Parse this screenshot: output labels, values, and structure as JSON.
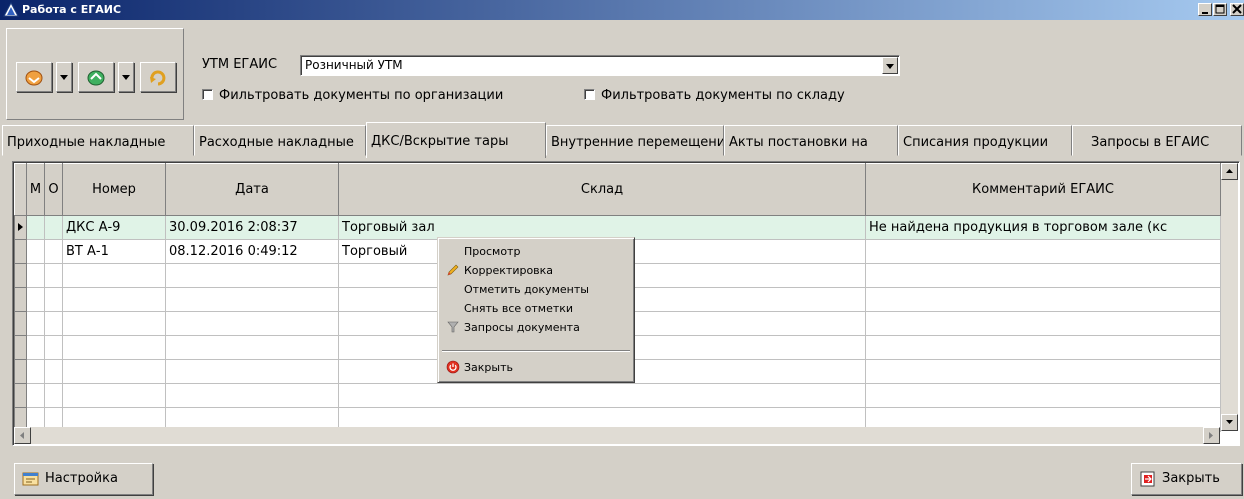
{
  "window": {
    "title": "Работа с ЕГАИС"
  },
  "toolbar": {
    "utm_label": "УТМ ЕГАИС",
    "utm_value": "Розничный УТМ",
    "filter_org_label": "Фильтровать документы по организации",
    "filter_warehouse_label": "Фильтровать документы по складу"
  },
  "tabs": [
    {
      "label": "Приходные накладные"
    },
    {
      "label": "Расходные накладные"
    },
    {
      "label": "ДКС/Вскрытие тары"
    },
    {
      "label": "Внутренние перемещения"
    },
    {
      "label": "Акты постановки на"
    },
    {
      "label": "Списания продукции"
    },
    {
      "label": "Запросы в ЕГАИС"
    }
  ],
  "grid": {
    "columns": [
      "М",
      "О",
      "Номер",
      "Дата",
      "Склад",
      "Комментарий ЕГАИС"
    ],
    "rows": [
      {
        "m": "",
        "o": "",
        "number": "ДКС А-9",
        "date": "30.09.2016 2:08:37",
        "warehouse": "Торговый зал",
        "comment": "Не найдена продукция в торговом зале (кс"
      },
      {
        "m": "",
        "o": "",
        "number": "ВТ А-1",
        "date": "08.12.2016 0:49:12",
        "warehouse": "Торговый",
        "comment": ""
      }
    ]
  },
  "context_menu": {
    "items": [
      {
        "label": "Просмотр",
        "icon": ""
      },
      {
        "label": "Корректировка",
        "icon": "pencil-icon"
      },
      {
        "label": "Отметить документы",
        "icon": ""
      },
      {
        "label": "Снять все отметки",
        "icon": ""
      },
      {
        "label": "Запросы документа",
        "icon": "filter-icon"
      },
      {
        "label": "Закрыть",
        "icon": "power-icon"
      }
    ]
  },
  "bottom": {
    "settings_label": "Настройка",
    "close_label": "Закрыть"
  }
}
